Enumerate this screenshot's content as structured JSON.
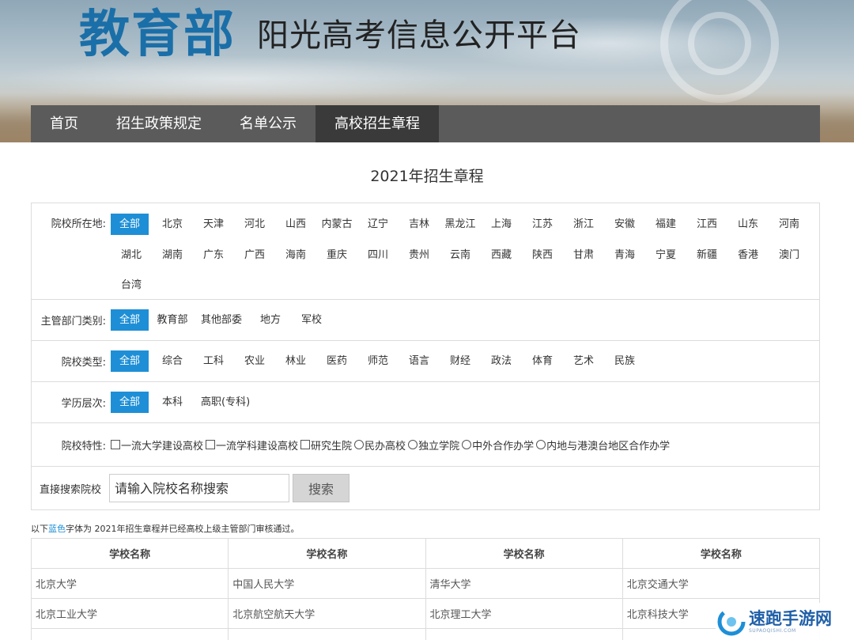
{
  "header": {
    "logo_main": "教育部",
    "logo_sub": "阳光高考信息公开平台"
  },
  "nav": [
    "首页",
    "招生政策规定",
    "名单公示",
    "高校招生章程"
  ],
  "page_title": "2021年招生章程",
  "filters": {
    "region": {
      "label": "院校所在地:",
      "options": [
        "全部",
        "北京",
        "天津",
        "河北",
        "山西",
        "内蒙古",
        "辽宁",
        "吉林",
        "黑龙江",
        "上海",
        "江苏",
        "浙江",
        "安徽",
        "福建",
        "江西",
        "山东",
        "河南",
        "湖北",
        "湖南",
        "广东",
        "广西",
        "海南",
        "重庆",
        "四川",
        "贵州",
        "云南",
        "西藏",
        "陕西",
        "甘肃",
        "青海",
        "宁夏",
        "新疆",
        "香港",
        "澳门",
        "台湾"
      ],
      "selected": "全部"
    },
    "dept": {
      "label": "主管部门类别:",
      "options": [
        "全部",
        "教育部",
        "其他部委",
        "地方",
        "军校"
      ],
      "selected": "全部"
    },
    "type": {
      "label": "院校类型:",
      "options": [
        "全部",
        "综合",
        "工科",
        "农业",
        "林业",
        "医药",
        "师范",
        "语言",
        "财经",
        "政法",
        "体育",
        "艺术",
        "民族"
      ],
      "selected": "全部"
    },
    "level": {
      "label": "学历层次:",
      "options": [
        "全部",
        "本科",
        "高职(专科)"
      ],
      "selected": "全部"
    },
    "feature": {
      "label": "院校特性:",
      "checkboxes": [
        "一流大学建设高校",
        "一流学科建设高校",
        "研究生院"
      ],
      "radios": [
        "民办高校",
        "独立学院",
        "中外合作办学",
        "内地与港澳台地区合作办学"
      ]
    },
    "search": {
      "label": "直接搜索院校",
      "placeholder": "请输入院校名称搜索",
      "button": "搜索"
    }
  },
  "note": {
    "prefix": "以下",
    "blue": "蓝色",
    "suffix": "字体为 2021年招生章程并已经高校上级主管部门审核通过。"
  },
  "table": {
    "headers": [
      "学校名称",
      "学校名称",
      "学校名称",
      "学校名称"
    ],
    "rows": [
      [
        "北京大学",
        "中国人民大学",
        "清华大学",
        "北京交通大学"
      ],
      [
        "北京工业大学",
        "北京航空航天大学",
        "北京理工大学",
        "北京科技大学"
      ],
      [
        "",
        "",
        "",
        ""
      ]
    ]
  },
  "watermark": {
    "title": "速跑手游网",
    "sub": "SUPAOQISHI.COM"
  },
  "colors": {
    "accent": "#1e8fd6",
    "nav_bg": "#5b5b5b",
    "nav_active": "#3a3a3a",
    "logo": "#1a6fa8"
  }
}
